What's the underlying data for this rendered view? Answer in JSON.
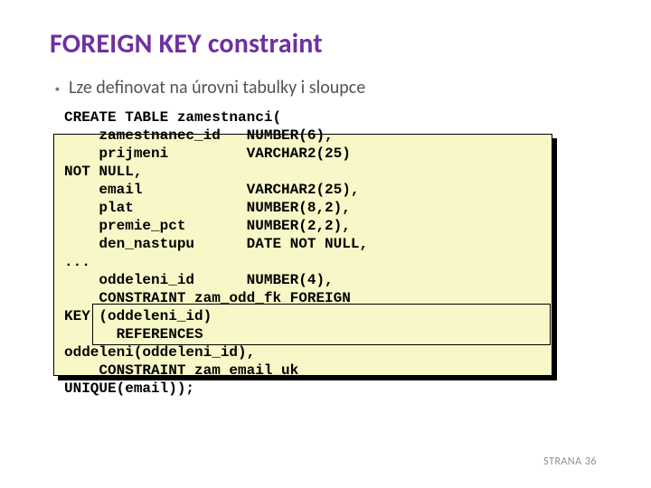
{
  "title": "FOREIGN KEY constraint",
  "bullet": "Lze definovat na úrovni tabulky i sloupce",
  "code": {
    "l1": "CREATE TABLE zamestnanci(",
    "l2": "    zamestnanec_id   NUMBER(6),",
    "l3": "    prijmeni         VARCHAR2(25)",
    "l4": "NOT NULL,",
    "l5": "    email            VARCHAR2(25),",
    "l6": "    plat             NUMBER(8,2),",
    "l7": "    premie_pct       NUMBER(2,2),",
    "l8": "    den_nastupu      DATE NOT NULL,",
    "l9": "...",
    "l10": "    oddeleni_id      NUMBER(4),",
    "l11": "    CONSTRAINT zam_odd_fk FOREIGN",
    "l12": "KEY (oddeleni_id)",
    "l13": "      REFERENCES",
    "l14": "oddeleni(oddeleni_id),",
    "l15": "    CONSTRAINT zam_email_uk",
    "l16": "UNIQUE(email));"
  },
  "footer_label": "STRANA",
  "footer_num": "36"
}
